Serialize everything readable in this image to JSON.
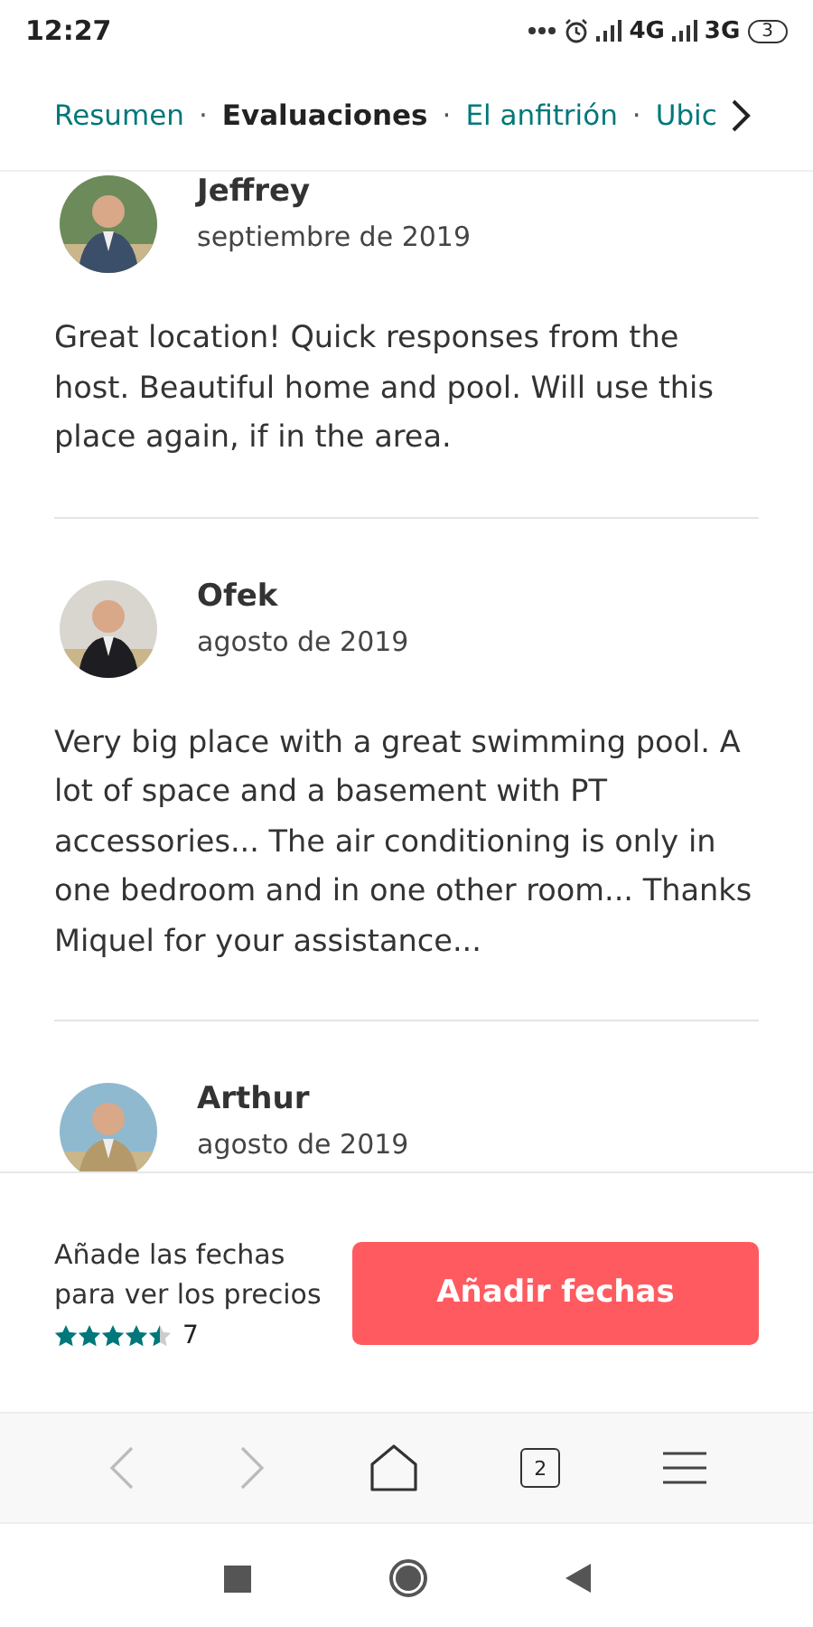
{
  "status_bar": {
    "time": "12:27",
    "network_1": "4G",
    "network_2": "3G",
    "battery": "3"
  },
  "tab_separator": "·",
  "tabs": [
    {
      "label": "Resumen",
      "selected": false
    },
    {
      "label": "Evaluaciones",
      "selected": true
    },
    {
      "label": "El anfitrión",
      "selected": false
    },
    {
      "label": "Ubic",
      "selected": false
    }
  ],
  "reviews": [
    {
      "name": "Jeffrey",
      "date": "septiembre de 2019",
      "text": "Great location! Quick responses from the host. Beautiful home and pool. Will use this place again, if in the area."
    },
    {
      "name": "Ofek",
      "date": "agosto de 2019",
      "text": "Very big place with a great swimming pool. A lot of space and a basement with PT accessories... The air conditioning is only in one bedroom and in one other room... Thanks Miquel for your assistance..."
    },
    {
      "name": "Arthur",
      "date": "agosto de 2019"
    }
  ],
  "footer": {
    "prompt": "Añade las fechas para ver los precios",
    "stars": 4.5,
    "review_count": "7",
    "button": "Añadir fechas"
  },
  "browser_bar": {
    "tab_count": "2"
  }
}
